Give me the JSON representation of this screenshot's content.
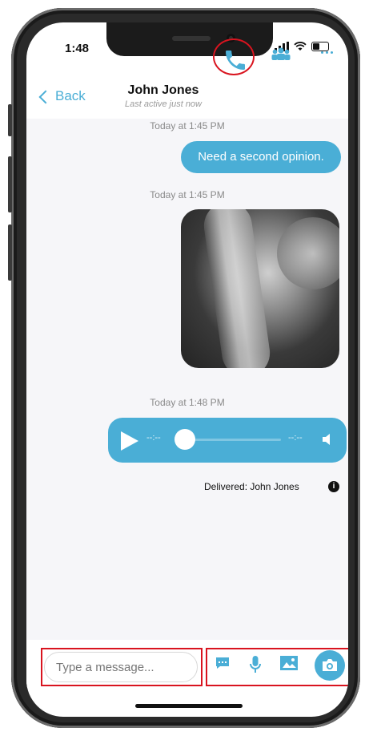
{
  "status_bar": {
    "time": "1:48"
  },
  "nav": {
    "back_label": "Back",
    "title": "John Jones",
    "subtitle": "Last active just now"
  },
  "messages": [
    {
      "timestamp": "Today at 1:45 PM",
      "text": "Need a second opinion."
    },
    {
      "timestamp": "Today at 1:45 PM",
      "kind": "image"
    },
    {
      "timestamp": "Today at 1:48 PM",
      "kind": "audio",
      "elapsed": "--:--",
      "duration": "--:--"
    }
  ],
  "delivery": {
    "text": "Delivered: John Jones"
  },
  "composer": {
    "placeholder": "Type a message..."
  },
  "colors": {
    "accent": "#4aaed6",
    "highlight": "#d9141f"
  },
  "icons": [
    "phone-icon",
    "group-icon",
    "more-icon",
    "chat-icon",
    "microphone-icon",
    "image-icon",
    "camera-icon",
    "play-icon",
    "volume-icon",
    "info-icon"
  ]
}
